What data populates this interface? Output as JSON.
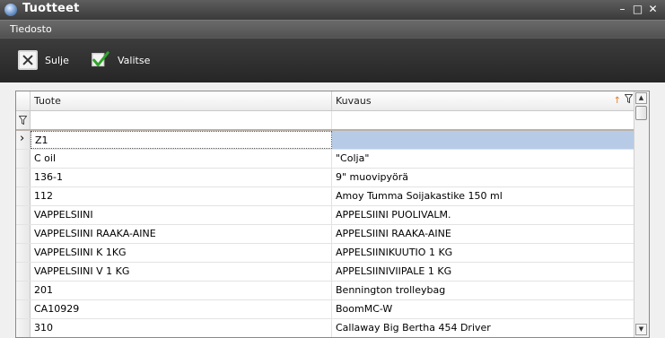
{
  "window": {
    "title": "Tuotteet",
    "controls": {
      "minimize": "–",
      "maximize": "□",
      "close": "✕"
    }
  },
  "menu": {
    "items": [
      "Tiedosto"
    ]
  },
  "toolbar": {
    "close_label": "Sulje",
    "select_label": "Valitse"
  },
  "grid": {
    "columns": [
      "Tuote",
      "Kuvaus"
    ],
    "sort_indicator": "↑",
    "filter_icon": "filter-icon",
    "selected_row_marker": "›",
    "rows": [
      {
        "product": "Z1",
        "description": ""
      },
      {
        "product": "C oil",
        "description": "\"Colja\""
      },
      {
        "product": "136-1",
        "description": "9\" muovipyörä"
      },
      {
        "product": "112",
        "description": "Amoy Tumma Soijakastike 150 ml"
      },
      {
        "product": "VAPPELSIINI",
        "description": "APPELSIINI PUOLIVALM."
      },
      {
        "product": "VAPPELSIINI RAAKA-AINE",
        "description": "APPELSIINI RAAKA-AINE"
      },
      {
        "product": "VAPPELSIINI K 1KG",
        "description": "APPELSIINIKUUTIO 1 KG"
      },
      {
        "product": "VAPPELSIINI V 1 KG",
        "description": "APPELSIINIVIIPALE 1 KG"
      },
      {
        "product": "201",
        "description": "Bennington trolleybag"
      },
      {
        "product": "CA10929",
        "description": "BoomMC-W"
      },
      {
        "product": "310",
        "description": "Callaway Big Bertha 454 Driver"
      }
    ]
  },
  "colors": {
    "selected_cell": "#b7cbe6",
    "chrome_dark": "#2e2e2e"
  }
}
